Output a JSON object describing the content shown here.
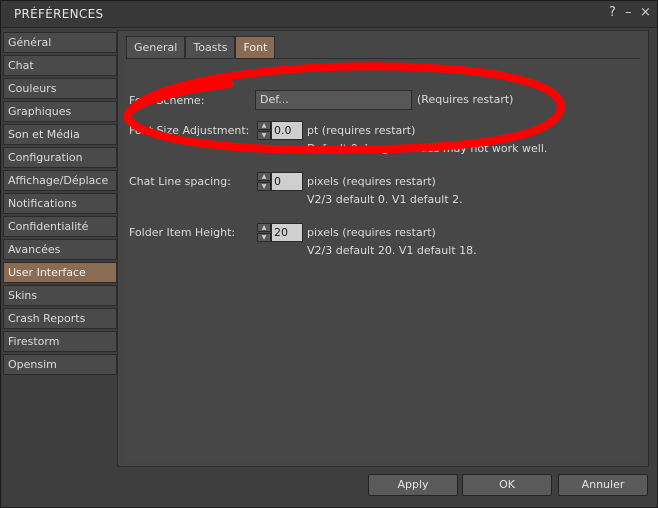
{
  "window": {
    "title": "PRÉFÉRENCES"
  },
  "titlebar_icons": {
    "help": "?",
    "minimize": "–",
    "close": "×"
  },
  "sidebar": {
    "items": [
      {
        "label": "Général"
      },
      {
        "label": "Chat"
      },
      {
        "label": "Couleurs"
      },
      {
        "label": "Graphiques"
      },
      {
        "label": "Son et Média"
      },
      {
        "label": "Configuration"
      },
      {
        "label": "Affichage/Déplace"
      },
      {
        "label": "Notifications"
      },
      {
        "label": "Confidentialité"
      },
      {
        "label": "Avancées"
      },
      {
        "label": "User Interface"
      },
      {
        "label": "Skins"
      },
      {
        "label": "Crash Reports"
      },
      {
        "label": "Firestorm"
      },
      {
        "label": "Opensim"
      }
    ],
    "selected": "User Interface"
  },
  "tabs": [
    {
      "label": "General"
    },
    {
      "label": "Toasts"
    },
    {
      "label": "Font"
    }
  ],
  "active_tab": "Font",
  "font": {
    "scheme": {
      "label": "Font Scheme:",
      "value": "Def...",
      "note": "(Requires restart)"
    },
    "size_adjustment": {
      "label": "Font Size Adjustment:",
      "value": "0.0",
      "unit_note": "pt (requires restart)",
      "help": "Default 0. Larger values may not work well."
    },
    "chat_line_spacing": {
      "label": "Chat Line spacing:",
      "value": "0",
      "unit_note": "pixels (requires restart)",
      "help": "V2/3 default 0. V1 default 2."
    },
    "folder_item_height": {
      "label": "Folder Item Height:",
      "value": "20",
      "unit_note": "pixels (requires restart)",
      "help": "V2/3 default 20. V1 default 18."
    }
  },
  "footer": {
    "apply": "Apply",
    "ok": "OK",
    "cancel": "Annuler"
  },
  "colors": {
    "accent": "#8a6b53",
    "annotation": "#ff0000"
  }
}
